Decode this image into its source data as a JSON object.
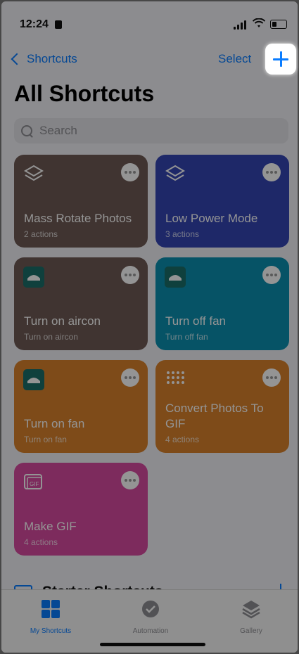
{
  "status": {
    "time": "12:24"
  },
  "nav": {
    "back_label": "Shortcuts",
    "select_label": "Select"
  },
  "page": {
    "title": "All Shortcuts"
  },
  "search": {
    "placeholder": "Search"
  },
  "shortcuts": [
    {
      "title": "Mass Rotate Photos",
      "subtitle": "2 actions",
      "color": "#6e5a55",
      "icon": "layers-icon"
    },
    {
      "title": "Low Power Mode",
      "subtitle": "3 actions",
      "color": "#3445b4",
      "icon": "layers-icon"
    },
    {
      "title": "Turn on aircon",
      "subtitle": "Turn on aircon",
      "color": "#6e5a55",
      "icon": "aircon-icon"
    },
    {
      "title": "Turn off fan",
      "subtitle": "Turn off fan",
      "color": "#0b8fb0",
      "icon": "aircon-icon"
    },
    {
      "title": "Turn on fan",
      "subtitle": "Turn on fan",
      "color": "#d9822b",
      "icon": "aircon-icon"
    },
    {
      "title": "Convert Photos To GIF",
      "subtitle": "4 actions",
      "color": "#d9822b",
      "icon": "grid-dots-icon"
    },
    {
      "title": "Make GIF",
      "subtitle": "4 actions",
      "color": "#d84aa0",
      "icon": "gif-icon"
    }
  ],
  "section": {
    "title": "Starter Shortcuts"
  },
  "tabs": [
    {
      "label": "My Shortcuts",
      "active": true,
      "icon": "grid-icon"
    },
    {
      "label": "Automation",
      "active": false,
      "icon": "clock-check-icon"
    },
    {
      "label": "Gallery",
      "active": false,
      "icon": "layers-icon"
    }
  ],
  "colors": {
    "accent": "#0a7cff"
  }
}
